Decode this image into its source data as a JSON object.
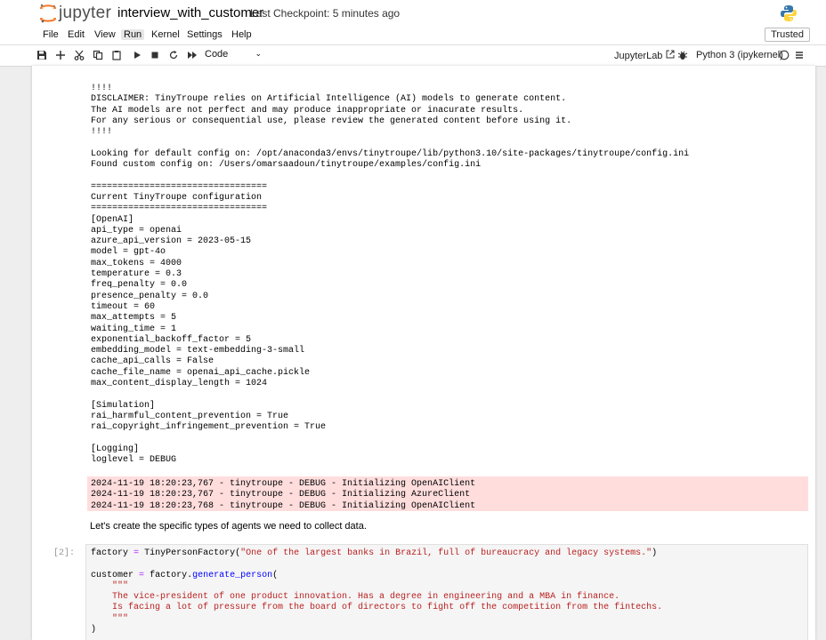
{
  "header": {
    "logo_text": "jupyter",
    "notebook_name": "interview_with_customer",
    "checkpoint": "Last Checkpoint: 5 minutes ago",
    "trusted": "Trusted"
  },
  "menu": [
    "File",
    "Edit",
    "View",
    "Run",
    "Kernel",
    "Settings",
    "Help"
  ],
  "toolbar": {
    "cell_type": "Code",
    "jupyterlab": "JupyterLab",
    "kernel_name": "Python 3 (ipykernel)"
  },
  "output": {
    "stdout": "!!!!\nDISCLAIMER: TinyTroupe relies on Artificial Intelligence (AI) models to generate content.\nThe AI models are not perfect and may produce inappropriate or inacurate results.\nFor any serious or consequential use, please review the generated content before using it.\n!!!!\n\nLooking for default config on: /opt/anaconda3/envs/tinytroupe/lib/python3.10/site-packages/tinytroupe/config.ini\nFound custom config on: /Users/omarsaadoun/tinytroupe/examples/config.ini\n\n=================================\nCurrent TinyTroupe configuration\n=================================\n[OpenAI]\napi_type = openai\nazure_api_version = 2023-05-15\nmodel = gpt-4o\nmax_tokens = 4000\ntemperature = 0.3\nfreq_penalty = 0.0\npresence_penalty = 0.0\ntimeout = 60\nmax_attempts = 5\nwaiting_time = 1\nexponential_backoff_factor = 5\nembedding_model = text-embedding-3-small\ncache_api_calls = False\ncache_file_name = openai_api_cache.pickle\nmax_content_display_length = 1024\n\n[Simulation]\nrai_harmful_content_prevention = True\nrai_copyright_infringement_prevention = True\n\n[Logging]\nloglevel = DEBUG",
    "stderr": "2024-11-19 18:20:23,767 - tinytroupe - DEBUG - Initializing OpenAIClient\n2024-11-19 18:20:23,767 - tinytroupe - DEBUG - Initializing AzureClient\n2024-11-19 18:20:23,768 - tinytroupe - DEBUG - Initializing OpenAIClient"
  },
  "markdown": "Let's create the specific types of agents we need to collect data.",
  "code_cell": {
    "prompt": "[2]:",
    "t_factory": "factory",
    "t_eq": "=",
    "t_tpf": "TinyPersonFactory(",
    "t_str1": "\"One of the largest banks in Brazil, full of bureaucracy and legacy systems.\"",
    "t_close": ")",
    "t_customer": "customer",
    "t_eq2": "=",
    "t_factory2": "factory.",
    "t_gen": "generate_person",
    "t_open": "(",
    "t_doc": "    \"\"\"\n    The vice-president of one product innovation. Has a degree in engineering and a MBA in finance.\n    Is facing a lot of pressure from the board of directors to fight off the competition from the fintechs.\n    \"\"\"",
    "t_close2": ")"
  }
}
